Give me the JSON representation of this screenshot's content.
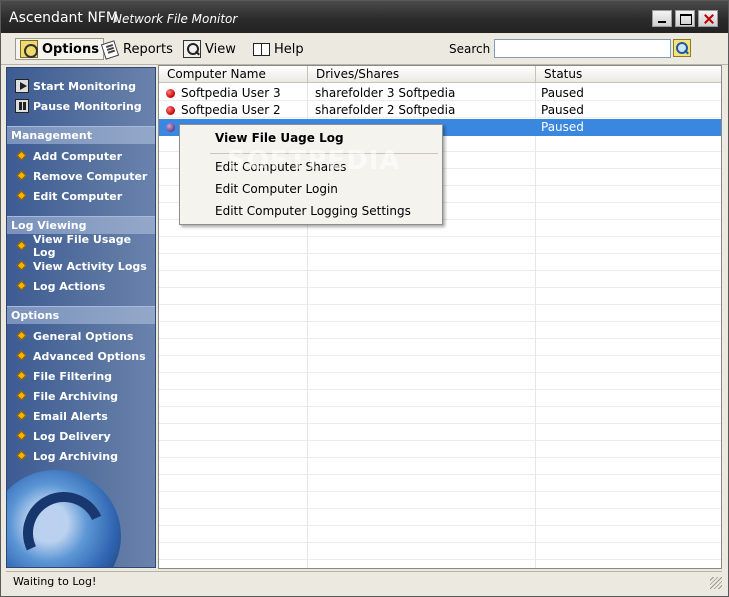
{
  "window": {
    "app_name": "Ascendant NFM",
    "subtitle": "Network File Monitor"
  },
  "toolbar": {
    "options_label": "Options",
    "reports_label": "Reports",
    "view_label": "View",
    "help_label": "Help",
    "search_label": "Search",
    "search_value": ""
  },
  "sidebar": {
    "monitoring": [
      {
        "label": "Start Monitoring",
        "icon": "play-icon"
      },
      {
        "label": "Pause Monitoring",
        "icon": "pause-icon"
      }
    ],
    "sections": [
      {
        "title": "Management",
        "items": [
          "Add Computer",
          "Remove Computer",
          "Edit Computer"
        ]
      },
      {
        "title": "Log Viewing",
        "items": [
          "View File Usage Log",
          "View Activity Logs",
          "Log Actions"
        ]
      },
      {
        "title": "Options",
        "items": [
          "General Options",
          "Advanced Options",
          "File Filtering",
          "File Archiving",
          "Email Alerts",
          "Log Delivery",
          "Log Archiving"
        ]
      }
    ]
  },
  "table": {
    "columns": [
      "Computer Name",
      "Drives/Shares",
      "Status"
    ],
    "rows": [
      {
        "name": "Softpedia User 3",
        "shares": "sharefolder 3 Softpedia",
        "status": "Paused",
        "selected": false
      },
      {
        "name": "Softpedia User 2",
        "shares": "sharefolder 2 Softpedia",
        "status": "Paused",
        "selected": false
      },
      {
        "name": "",
        "shares": "",
        "status": "Paused",
        "selected": true
      }
    ]
  },
  "context_menu": {
    "items": [
      {
        "label": "View File Uage Log",
        "bold": true
      },
      {
        "label": "Edit Computer Shares",
        "bold": false
      },
      {
        "label": "Edit Computer Login",
        "bold": false
      },
      {
        "label": "Editt Computer Logging Settings",
        "bold": false
      }
    ]
  },
  "watermark": "SOFTPEDIA",
  "status_bar": {
    "text": "Waiting to Log!"
  },
  "colors": {
    "selection": "#3a87e0",
    "sidebar": "#4a6699",
    "status_dot": "#c40000"
  }
}
